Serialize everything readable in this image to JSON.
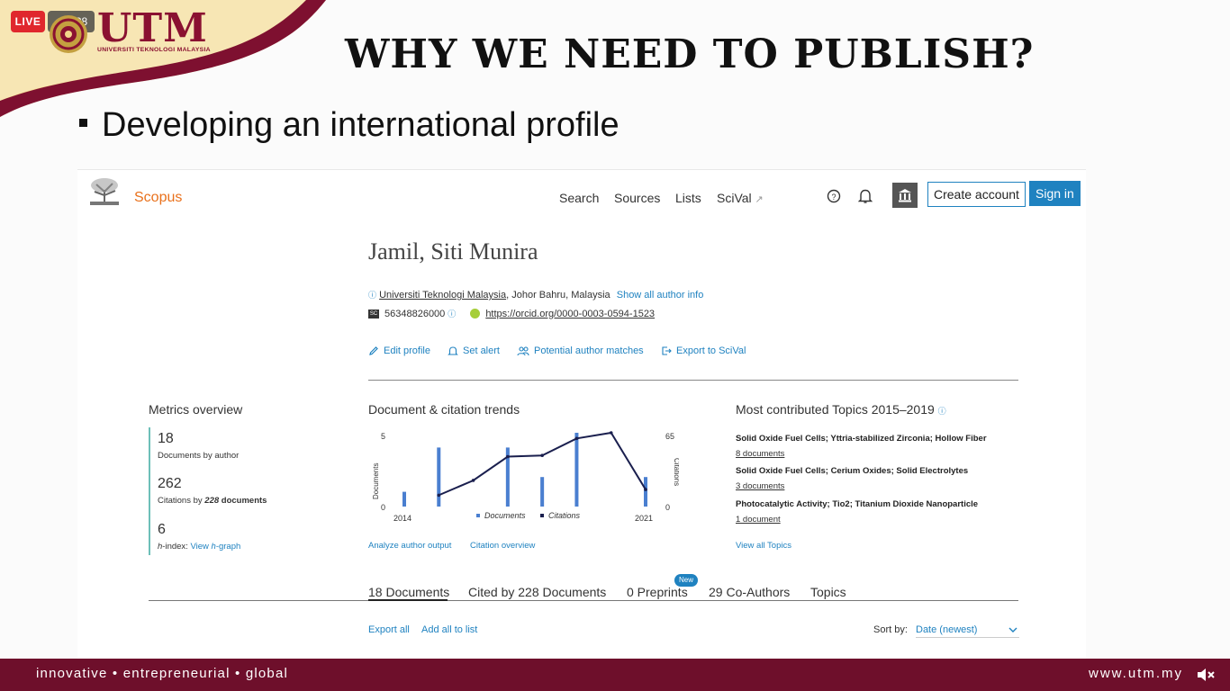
{
  "overlay": {
    "live_label": "LIVE",
    "viewer_count": "38"
  },
  "logo": {
    "name": "UTM",
    "subtitle": "UNIVERSITI TEKNOLOGI MALAYSIA"
  },
  "slide": {
    "title": "WHY WE NEED TO PUBLISH?",
    "bullet": "Developing an international profile",
    "footer_tagline": "innovative • entrepreneurial • global",
    "footer_url": "www.utm.my"
  },
  "scopus": {
    "brand": "Scopus",
    "nav": {
      "search": "Search",
      "sources": "Sources",
      "lists": "Lists",
      "scival": "SciVal"
    },
    "create_account": "Create account",
    "sign_in": "Sign in",
    "author_name": "Jamil, Siti Munira",
    "affiliation_link": "Universiti Teknologi Malaysia",
    "affiliation_location": ", Johor Bahru, Malaysia",
    "show_all": "Show all author info",
    "author_id": "56348826000",
    "orcid_url": "https://orcid.org/0000-0003-0594-1523",
    "actions": {
      "edit": "Edit profile",
      "alert": "Set alert",
      "matches": "Potential author matches",
      "export": "Export to SciVal"
    },
    "metrics": {
      "heading": "Metrics overview",
      "docs_value": "18",
      "docs_label": "Documents by author",
      "cit_value": "262",
      "cit_label_prefix": "Citations by ",
      "cit_label_num": "228",
      "cit_label_suffix": " documents",
      "h_value": "6",
      "h_label_h": "h",
      "h_label_rest": "-index:",
      "h_link_prefix": "View ",
      "h_link_h": "h",
      "h_link_suffix": "-graph"
    },
    "trends": {
      "heading": "Document & citation trends",
      "analyze": "Analyze author output",
      "citation_overview": "Citation overview"
    },
    "topics": {
      "heading": "Most contributed Topics 2015–2019",
      "items": [
        {
          "title": "Solid Oxide Fuel Cells; Yttria-stabilized Zirconia; Hollow Fiber",
          "count": "8 documents"
        },
        {
          "title": "Solid Oxide Fuel Cells; Cerium Oxides; Solid Electrolytes",
          "count": "3 documents"
        },
        {
          "title": "Photocatalytic Activity; Tio2; Titanium Dioxide Nanoparticle",
          "count": "1 document"
        }
      ],
      "view_all": "View all Topics"
    },
    "tabs": {
      "documents": "18 Documents",
      "cited_by": "Cited by 228 Documents",
      "preprints": "0 Preprints",
      "coauthors": "29 Co-Authors",
      "topics": "Topics",
      "new_badge": "New"
    },
    "list_actions": {
      "export_all": "Export all",
      "add_all": "Add all to list",
      "sort_label": "Sort by:",
      "sort_value": "Date (newest)"
    }
  },
  "chart_data": {
    "type": "bar",
    "x": [
      2014,
      2015,
      2016,
      2017,
      2018,
      2019,
      2020,
      2021
    ],
    "x_tick_labels": [
      "2014",
      "2021"
    ],
    "ylabel": "Documents",
    "y2label": "Citations",
    "ylim": [
      0,
      5
    ],
    "y2lim": [
      0,
      65
    ],
    "y_tick_labels": [
      "5",
      "0"
    ],
    "y2_tick_labels": [
      "65",
      "0"
    ],
    "series": [
      {
        "name": "Documents",
        "kind": "bar",
        "color": "#4a7fd0",
        "values": [
          1,
          4,
          0,
          4,
          2,
          5,
          0,
          2
        ]
      },
      {
        "name": "Citations",
        "kind": "line",
        "color": "#1a1f4e",
        "values": [
          null,
          10,
          23,
          44,
          45,
          60,
          65,
          15
        ]
      }
    ]
  }
}
